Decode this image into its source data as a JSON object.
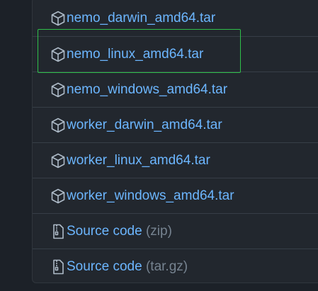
{
  "assets": [
    {
      "name": "nemo_darwin_amd64.tar",
      "icon": "package-icon"
    },
    {
      "name": "nemo_linux_amd64.tar",
      "icon": "package-icon"
    },
    {
      "name": "nemo_windows_amd64.tar",
      "icon": "package-icon"
    },
    {
      "name": "worker_darwin_amd64.tar",
      "icon": "package-icon"
    },
    {
      "name": "worker_linux_amd64.tar",
      "icon": "package-icon"
    },
    {
      "name": "worker_windows_amd64.tar",
      "icon": "package-icon"
    }
  ],
  "source": [
    {
      "label": "Source code",
      "format": "(zip)",
      "icon": "file-zip-icon"
    },
    {
      "label": "Source code",
      "format": "(tar.gz)",
      "icon": "file-zip-icon"
    }
  ],
  "colors": {
    "link": "#6cb6ff",
    "muted": "#768390",
    "highlight": "#2fbf4a",
    "background": "#22272e"
  }
}
